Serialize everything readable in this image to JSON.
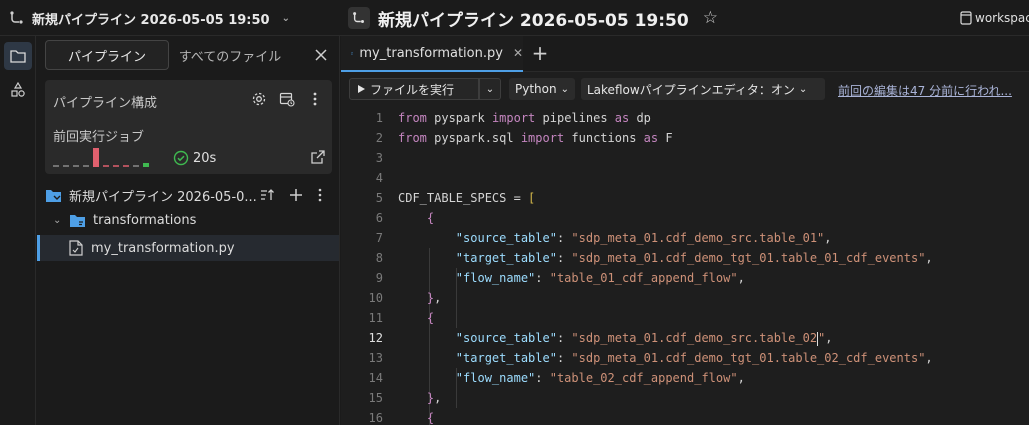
{
  "window": {
    "left_title": "新規パイプライン 2026-05-05 19:50",
    "center_title": "新規パイプライン 2026-05-05 19:50",
    "workspace_label": "workspac"
  },
  "sidebar": {
    "tabs": [
      {
        "label": "パイプライン",
        "active": true
      },
      {
        "label": "すべてのファイル",
        "active": false
      }
    ],
    "config": {
      "title": "パイプライン構成",
      "last_run_label": "前回実行ジョブ",
      "last_run_duration": "20s"
    },
    "tree": {
      "root": "新規パイプライン 2026-05-0...",
      "folder": "transformations",
      "file": "my_transformation.py"
    }
  },
  "editor": {
    "tab_label": "my_transformation.py",
    "toolbar": {
      "run_label": "ファイルを実行",
      "language": "Python",
      "lakeflow": "Lakeflowパイプラインエディタ：オン",
      "last_edit": "前回の編集は47 分前に行われ..."
    },
    "current_line": 12,
    "lines": [
      {
        "n": "1",
        "parts": [
          [
            "kw",
            "from"
          ],
          [
            "",
            " pyspark "
          ],
          [
            "kw",
            "import"
          ],
          [
            "",
            " pipelines "
          ],
          [
            "kw",
            "as"
          ],
          [
            "",
            " dp"
          ]
        ]
      },
      {
        "n": "2",
        "parts": [
          [
            "kw",
            "from"
          ],
          [
            "",
            " pyspark.sql "
          ],
          [
            "kw",
            "import"
          ],
          [
            "",
            " functions "
          ],
          [
            "kw",
            "as"
          ],
          [
            "",
            " F"
          ]
        ]
      },
      {
        "n": "3",
        "parts": []
      },
      {
        "n": "4",
        "parts": []
      },
      {
        "n": "5",
        "parts": [
          [
            "",
            "CDF_TABLE_SPECS = "
          ],
          [
            "brk",
            "["
          ]
        ]
      },
      {
        "n": "6",
        "parts": [
          [
            "",
            "    "
          ],
          [
            "brc",
            "{"
          ]
        ]
      },
      {
        "n": "7",
        "parts": [
          [
            "",
            "        "
          ],
          [
            "key",
            "\"source_table\""
          ],
          [
            "",
            ": "
          ],
          [
            "str",
            "\"sdp_meta_01.cdf_demo_src.table_01\""
          ],
          [
            "",
            ","
          ]
        ]
      },
      {
        "n": "8",
        "parts": [
          [
            "",
            "        "
          ],
          [
            "key",
            "\"target_table\""
          ],
          [
            "",
            ": "
          ],
          [
            "str",
            "\"sdp_meta_01.cdf_demo_tgt_01.table_01_cdf_events\""
          ],
          [
            "",
            ","
          ]
        ]
      },
      {
        "n": "9",
        "parts": [
          [
            "",
            "        "
          ],
          [
            "key",
            "\"flow_name\""
          ],
          [
            "",
            ": "
          ],
          [
            "str",
            "\"table_01_cdf_append_flow\""
          ],
          [
            "",
            ","
          ]
        ]
      },
      {
        "n": "10",
        "parts": [
          [
            "",
            "    "
          ],
          [
            "brc",
            "}"
          ],
          [
            "",
            ","
          ]
        ]
      },
      {
        "n": "11",
        "parts": [
          [
            "",
            "    "
          ],
          [
            "brc",
            "{"
          ]
        ]
      },
      {
        "n": "12",
        "parts": [
          [
            "",
            "        "
          ],
          [
            "key",
            "\"source_table\""
          ],
          [
            "",
            ": "
          ],
          [
            "str",
            "\"sdp_meta_01.cdf_demo_src.table_02"
          ],
          [
            "cursor",
            ""
          ],
          [
            "str",
            "\""
          ],
          [
            "",
            ","
          ]
        ]
      },
      {
        "n": "13",
        "parts": [
          [
            "",
            "        "
          ],
          [
            "key",
            "\"target_table\""
          ],
          [
            "",
            ": "
          ],
          [
            "str",
            "\"sdp_meta_01.cdf_demo_tgt_01.table_02_cdf_events\""
          ],
          [
            "",
            ","
          ]
        ]
      },
      {
        "n": "14",
        "parts": [
          [
            "",
            "        "
          ],
          [
            "key",
            "\"flow_name\""
          ],
          [
            "",
            ": "
          ],
          [
            "str",
            "\"table_02_cdf_append_flow\""
          ],
          [
            "",
            ","
          ]
        ]
      },
      {
        "n": "15",
        "parts": [
          [
            "",
            "    "
          ],
          [
            "brc",
            "}"
          ],
          [
            "",
            ","
          ]
        ]
      },
      {
        "n": "16",
        "parts": [
          [
            "",
            "    "
          ],
          [
            "brc",
            "{"
          ]
        ]
      }
    ]
  },
  "colors": {
    "accent": "#4e9fe6",
    "success": "#3fb950",
    "run_failed": "#e0606e"
  }
}
